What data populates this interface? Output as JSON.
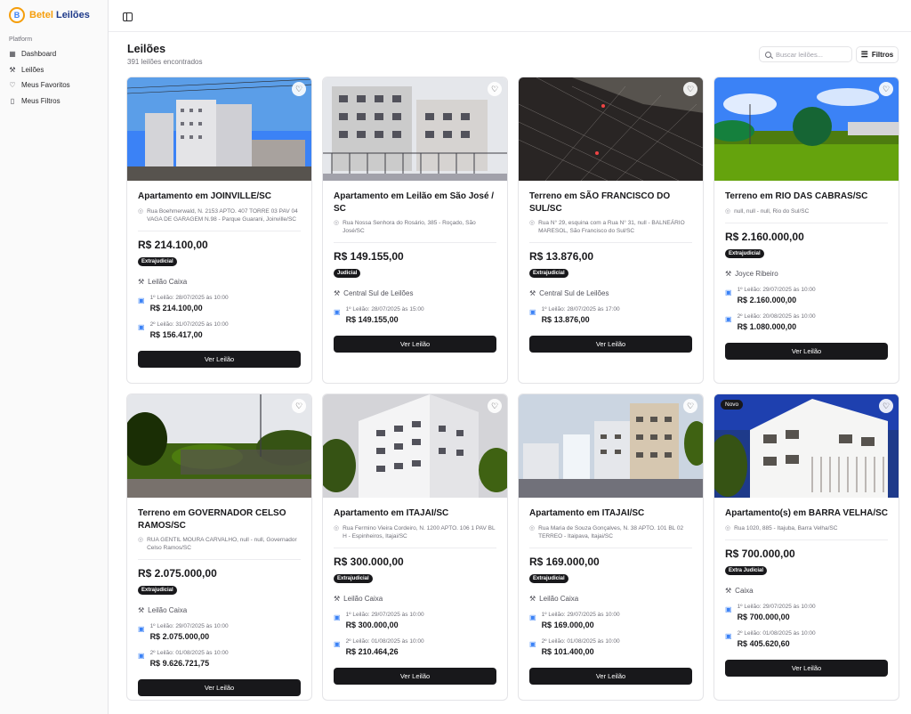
{
  "brand": {
    "logo_letter": "B",
    "name_part1": "Betel",
    "name_part2": "Leilões"
  },
  "sidebar": {
    "section": "Platform",
    "items": [
      {
        "label": "Dashboard",
        "icon": "grid-icon"
      },
      {
        "label": "Leilões",
        "icon": "gavel-icon"
      },
      {
        "label": "Meus Favoritos",
        "icon": "heart-icon"
      },
      {
        "label": "Meus Filtros",
        "icon": "bookmark-icon"
      }
    ]
  },
  "header": {
    "title": "Leilões",
    "subtitle": "391 leilões encontrados",
    "search_placeholder": "Buscar leilões...",
    "filter_label": "Filtros"
  },
  "common": {
    "view_button": "Ver Leilão"
  },
  "cards": [
    {
      "title": "Apartamento em JOINVILLE/SC",
      "address": "Rua Boehmerwald, N. 2153 APTO. 407 TORRE 03 PAV 04 VAGA DE GARAGEM N.98 - Parque Guarani, Joinville/SC",
      "price": "R$ 214.100,00",
      "type": "Extrajudicial",
      "auctioneer": "Leilão Caixa",
      "rounds": [
        {
          "label": "1º Leilão: 28/07/2025 às 10:00",
          "value": "R$ 214.100,00"
        },
        {
          "label": "2º Leilão: 31/07/2025 às 10:00",
          "value": "R$ 156.417,00"
        }
      ],
      "new_badge": ""
    },
    {
      "title": "Apartamento em Leilão em São José / SC",
      "address": "Rua Nossa Senhora do Rosário, 385 - Roçado, São José/SC",
      "price": "R$ 149.155,00",
      "type": "Judicial",
      "auctioneer": "Central Sul de Leilões",
      "rounds": [
        {
          "label": "1º Leilão: 28/07/2025 às 15:00",
          "value": "R$ 149.155,00"
        }
      ],
      "new_badge": ""
    },
    {
      "title": "Terreno em SÃO FRANCISCO DO SUL/SC",
      "address": "Rua N° 29, esquina com a Rua N° 31, null - BALNEÁRIO MARESOL, São Francisco do Sul/SC",
      "price": "R$ 13.876,00",
      "type": "Extrajudicial",
      "auctioneer": "Central Sul de Leilões",
      "rounds": [
        {
          "label": "1º Leilão: 28/07/2025 às 17:00",
          "value": "R$ 13.876,00"
        }
      ],
      "new_badge": ""
    },
    {
      "title": "Terreno em RIO DAS CABRAS/SC",
      "address": "null, null - null, Rio do Sul/SC",
      "price": "R$ 2.160.000,00",
      "type": "Extrajudicial",
      "auctioneer": "Joyce Ribeiro",
      "rounds": [
        {
          "label": "1º Leilão: 29/07/2025 às 10:00",
          "value": "R$ 2.160.000,00"
        },
        {
          "label": "2º Leilão: 20/08/2025 às 10:00",
          "value": "R$ 1.080.000,00"
        }
      ],
      "new_badge": ""
    },
    {
      "title": "Terreno em GOVERNADOR CELSO RAMOS/SC",
      "address": "RUA GENTIL MOURA CARVALHO, null - null, Governador Celso Ramos/SC",
      "price": "R$ 2.075.000,00",
      "type": "Extrajudicial",
      "auctioneer": "Leilão Caixa",
      "rounds": [
        {
          "label": "1º Leilão: 29/07/2025 às 10:00",
          "value": "R$ 2.075.000,00"
        },
        {
          "label": "2º Leilão: 01/08/2025 às 10:00",
          "value": "R$ 9.626.721,75"
        }
      ],
      "new_badge": ""
    },
    {
      "title": "Apartamento em ITAJAI/SC",
      "address": "Rua Fermino Vieira Cordeiro, N. 1200 APTO. 106 1 PAV BL H - Espinheiros, Itajai/SC",
      "price": "R$ 300.000,00",
      "type": "Extrajudicial",
      "auctioneer": "Leilão Caixa",
      "rounds": [
        {
          "label": "1º Leilão: 29/07/2025 às 10:00",
          "value": "R$ 300.000,00"
        },
        {
          "label": "2º Leilão: 01/08/2025 às 10:00",
          "value": "R$ 210.464,26"
        }
      ],
      "new_badge": ""
    },
    {
      "title": "Apartamento em ITAJAI/SC",
      "address": "Rua Maria de Souza Gonçalves, N. 38 APTO. 101 BL 02 TERREO - Itaipava, Itajai/SC",
      "price": "R$ 169.000,00",
      "type": "Extrajudicial",
      "auctioneer": "Leilão Caixa",
      "rounds": [
        {
          "label": "1º Leilão: 29/07/2025 às 10:00",
          "value": "R$ 169.000,00"
        },
        {
          "label": "2º Leilão: 01/08/2025 às 10:00",
          "value": "R$ 101.400,00"
        }
      ],
      "new_badge": ""
    },
    {
      "title": "Apartamento(s) em BARRA VELHA/SC",
      "address": "Rua 1020, 885 - Itajuba, Barra Velha/SC",
      "price": "R$ 700.000,00",
      "type": "Extra Judicial",
      "auctioneer": "Caixa",
      "rounds": [
        {
          "label": "1º Leilão: 29/07/2025 às 10:00",
          "value": "R$ 700.000,00"
        },
        {
          "label": "2º Leilão: 01/08/2025 às 10:00",
          "value": "R$ 405.620,60"
        }
      ],
      "new_badge": "Novo"
    }
  ]
}
